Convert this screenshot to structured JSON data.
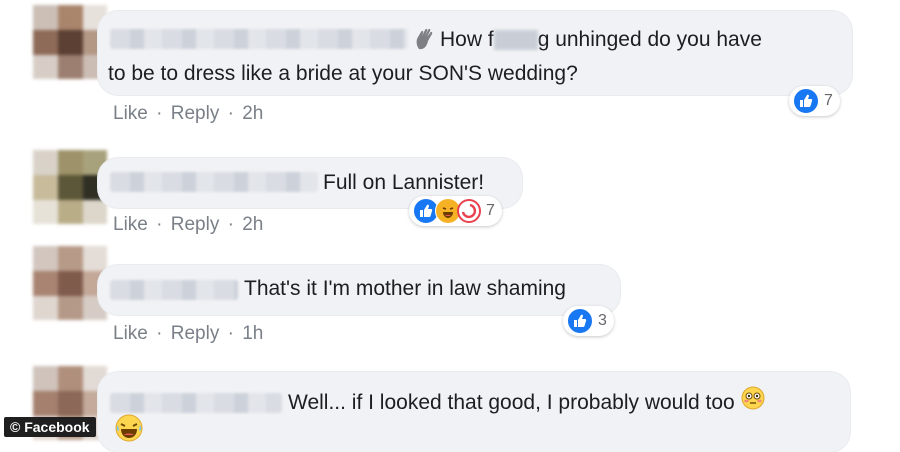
{
  "comments": [
    {
      "line1_pre": "How f",
      "line1_post": "g unhinged do you have",
      "line2": "to be to dress like a bride at your SON'S wedding?",
      "like": "Like",
      "sep": "·",
      "reply": "Reply",
      "time": "2h",
      "reaction_count": "7"
    },
    {
      "text": "Full on Lannister!",
      "like": "Like",
      "sep": "·",
      "reply": "Reply",
      "time": "2h",
      "reaction_count": "7"
    },
    {
      "text": "That's it I'm mother in law shaming",
      "like": "Like",
      "sep": "·",
      "reply": "Reply",
      "time": "1h",
      "reaction_count": "3"
    },
    {
      "text": "Well... if I looked that good, I probably would too"
    }
  ],
  "watermark": "© Facebook",
  "icons": {
    "like": "thumbs-up-icon",
    "haha": "laughing-face-icon",
    "wow": "surprised-face-icon",
    "wave": "waving-hand-icon",
    "flushed": "flushed-face-icon"
  },
  "colors": {
    "like_blue": "#1877f2",
    "haha_yellow": "#f7b125",
    "wow_red": "#e9414f",
    "bubble": "#f0f2f5",
    "meta_gray": "#7a8088"
  }
}
